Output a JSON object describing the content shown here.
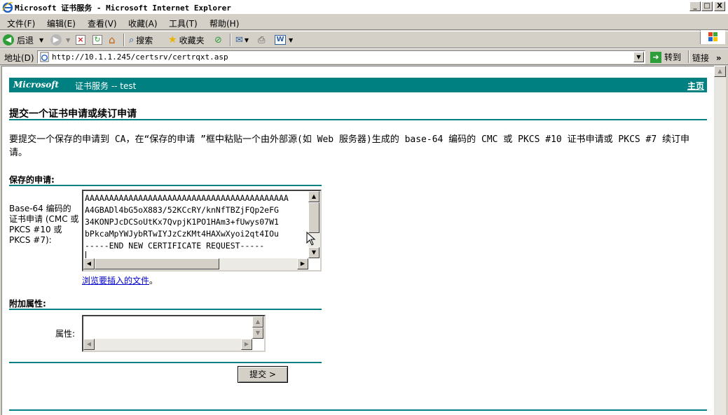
{
  "window": {
    "title": "Microsoft 证书服务 - Microsoft Internet Explorer",
    "minimize": "_",
    "maximize": "□",
    "close": "X"
  },
  "menu": {
    "items": [
      "文件(F)",
      "编辑(E)",
      "查看(V)",
      "收藏(A)",
      "工具(T)",
      "帮助(H)"
    ]
  },
  "toolbar": {
    "back_label": "后退",
    "search_label": "搜索",
    "favorites_label": "收藏夹"
  },
  "address": {
    "label": "地址(D)",
    "url": "http://10.1.1.245/certsrv/certrqxt.asp",
    "go_label": "转到",
    "links_label": "链接"
  },
  "page": {
    "banner_brand": "Microsoft",
    "banner_service": "证书服务 --  test",
    "home_link": "主页",
    "heading": "提交一个证书申请或续订申请",
    "instructions": "要提交一个保存的申请到 CA，在“保存的申请 ”框中粘贴一个由外部源(如 Web 服务器)生成的 base-64 编码的 CMC 或 PKCS #10 证书申请或 PKCS #7 续订申请。",
    "saved_request_title": "保存的申请:",
    "request_field_label": "Base-64 编码的证书申请 (CMC 或 PKCS #10 或 PKCS #7):",
    "request_lines": [
      "AAAAAAAAAAAAAAAAAAAAAAAAAAAAAAAAAAAAAAAAAA",
      "A4GBADl4bG5oX883/52KCcRY/knNfTBZjFQp2eFG",
      "34KONPJcDCSoUtKx7QvpjK1PO1HAm3+fUwys07W1",
      "bPkcaMpYWJybRTwIYJzCzKMt4HAXwXyoi2qt4IOu",
      "-----END NEW CERTIFICATE REQUEST-----",
      ""
    ],
    "browse_link": "浏览要插入的文件",
    "browse_suffix": "。",
    "extra_attrs_title": "附加属性:",
    "attrs_label": "属性:",
    "attrs_value": "",
    "submit_label": "提交 >"
  },
  "colors": {
    "banner": "#008080",
    "link": "#0000cc",
    "chrome": "#d4d0c8"
  }
}
